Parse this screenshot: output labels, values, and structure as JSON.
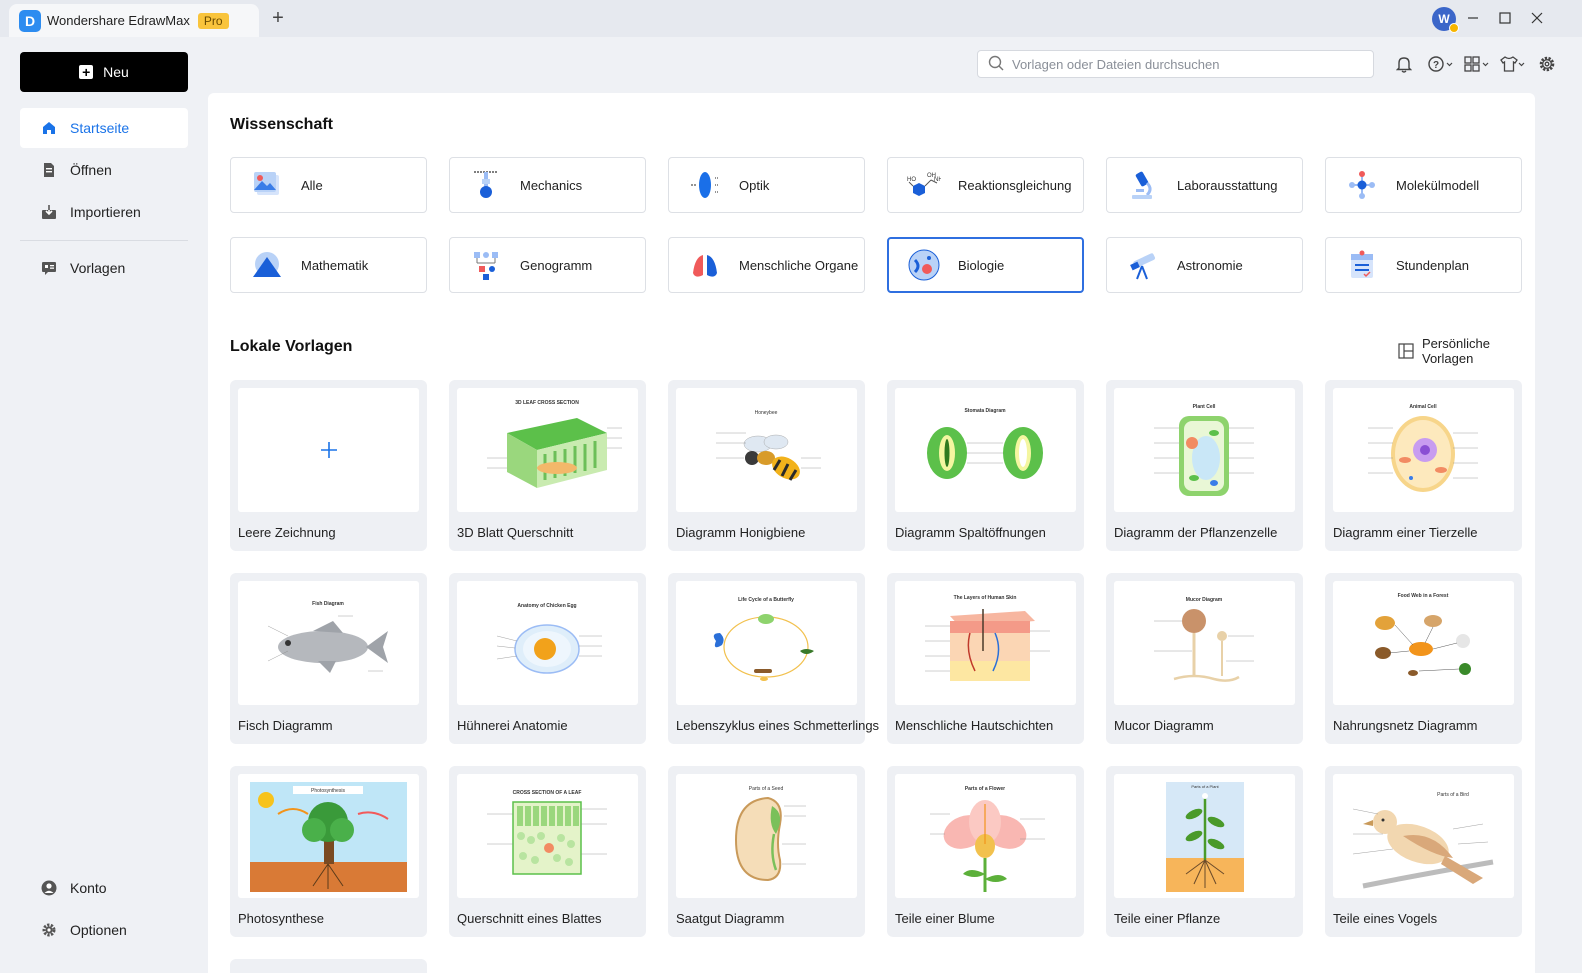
{
  "app": {
    "name": "Wondershare EdrawMax",
    "badge": "Pro",
    "new_tab_symbol": "+",
    "user_initial": "W"
  },
  "sidebar": {
    "new_label": "Neu",
    "items": [
      {
        "label": "Startseite",
        "icon": "home-icon",
        "active": true
      },
      {
        "label": "Öffnen",
        "icon": "file-icon",
        "active": false
      },
      {
        "label": "Importieren",
        "icon": "import-icon",
        "active": false
      },
      {
        "label": "Vorlagen",
        "icon": "templates-icon",
        "active": false
      }
    ],
    "bottom": [
      {
        "label": "Konto",
        "icon": "account-icon"
      },
      {
        "label": "Optionen",
        "icon": "gear-icon"
      }
    ]
  },
  "search": {
    "placeholder": "Vorlagen oder Dateien durchsuchen"
  },
  "science": {
    "title": "Wissenschaft",
    "categories": [
      {
        "label": "Alle",
        "icon": "image-icon"
      },
      {
        "label": "Mechanics",
        "icon": "pendulum-icon"
      },
      {
        "label": "Optik",
        "icon": "lens-icon"
      },
      {
        "label": "Reaktionsgleichung",
        "icon": "molecule-formula-icon"
      },
      {
        "label": "Laborausstattung",
        "icon": "microscope-icon"
      },
      {
        "label": "Molekülmodell",
        "icon": "molecule-icon"
      },
      {
        "label": "Mathematik",
        "icon": "triangle-icon"
      },
      {
        "label": "Genogramm",
        "icon": "genogram-icon"
      },
      {
        "label": "Menschliche Organe",
        "icon": "lungs-icon"
      },
      {
        "label": "Biologie",
        "icon": "cell-icon",
        "selected": true
      },
      {
        "label": "Astronomie",
        "icon": "telescope-icon"
      },
      {
        "label": "Stundenplan",
        "icon": "schedule-icon"
      }
    ]
  },
  "local": {
    "title": "Lokale Vorlagen",
    "personal_label": "Persönliche Vorlagen",
    "templates": [
      {
        "label": "Leere Zeichnung",
        "thumb_title": ""
      },
      {
        "label": "3D Blatt Querschnitt",
        "thumb_title": "3D LEAF CROSS SECTION"
      },
      {
        "label": "Diagramm Honigbiene",
        "thumb_title": "Honeybee"
      },
      {
        "label": "Diagramm Spaltöffnungen",
        "thumb_title": "Stomata Diagram"
      },
      {
        "label": "Diagramm der Pflanzenzelle",
        "thumb_title": "Plant Cell"
      },
      {
        "label": "Diagramm einer Tierzelle",
        "thumb_title": "Animal Cell"
      },
      {
        "label": "Fisch Diagramm",
        "thumb_title": "Fish Diagram"
      },
      {
        "label": "Hühnerei Anatomie",
        "thumb_title": "Anatomy of Chicken Egg"
      },
      {
        "label": "Lebenszyklus eines Schmetterlings",
        "thumb_title": "Life Cycle of a Butterfly"
      },
      {
        "label": "Menschliche Hautschichten",
        "thumb_title": "The Layers of Human Skin"
      },
      {
        "label": "Mucor Diagramm",
        "thumb_title": "Mucor Diagram"
      },
      {
        "label": "Nahrungsnetz Diagramm",
        "thumb_title": "Food Web in a Forest"
      },
      {
        "label": "Photosynthese",
        "thumb_title": "Photosynthesis"
      },
      {
        "label": "Querschnitt eines Blattes",
        "thumb_title": "CROSS SECTION OF A LEAF"
      },
      {
        "label": "Saatgut Diagramm",
        "thumb_title": "Parts of a Seed"
      },
      {
        "label": "Teile einer Blume",
        "thumb_title": "Parts of a Flower"
      },
      {
        "label": "Teile einer Pflanze",
        "thumb_title": "Parts of a Plant"
      },
      {
        "label": "Teile eines Vogels",
        "thumb_title": "Parts of a Bird"
      }
    ]
  },
  "colors": {
    "accent": "#1a73e8",
    "selected_border": "#2f6fe0",
    "pro_badge": "#f9c43c"
  }
}
